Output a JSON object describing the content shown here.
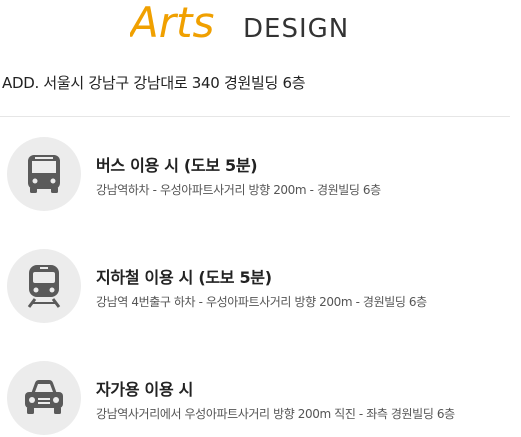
{
  "brand": {
    "logo_main": "Arts",
    "logo_sub": "DESIGN",
    "accent": "#f0a000",
    "sub_color": "#333333"
  },
  "address": "ADD. 서울시 강남구 강남대로 340 경원빌딩 6층",
  "routes": [
    {
      "icon": "bus-icon",
      "title": "버스 이용 시 (도보 5분)",
      "desc": "강남역하차 - 우성아파트사거리 방향 200m - 경원빌딩 6층"
    },
    {
      "icon": "subway-icon",
      "title": "지하철 이용 시 (도보 5분)",
      "desc": "강남역 4번출구 하차 - 우성아파트사거리 방향 200m - 경원빌딩 6층"
    },
    {
      "icon": "car-icon",
      "title": "자가용 이용 시",
      "desc": "강남역사거리에서 우성아파트사거리 방향 200m 직진 - 좌측 경원빌딩 6층"
    }
  ],
  "colors": {
    "icon_bg": "#ececec",
    "icon_fg": "#5a5a5a"
  }
}
